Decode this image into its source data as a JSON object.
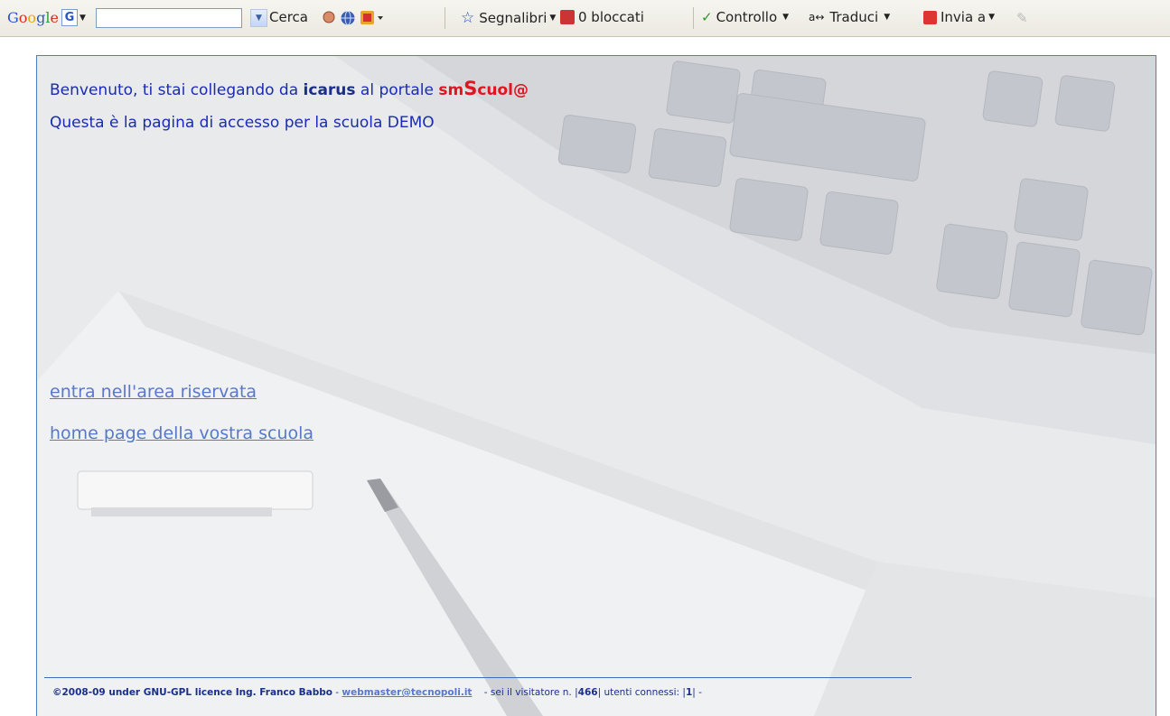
{
  "toolbar": {
    "logo_text": "Google",
    "g_button": "G",
    "search_placeholder": "",
    "search_button": "Cerca",
    "bookmarks": "Segnalibri",
    "blocked": "0 bloccati",
    "check": "Controllo",
    "translate": "Traduci",
    "send": "Invia a"
  },
  "page": {
    "welcome_prefix": "Benvenuto, ti stai collegando da ",
    "host": "icarus",
    "welcome_mid": " al portale ",
    "brand_a": "sm",
    "brand_b": "S",
    "brand_c": "cuol@",
    "access_text": "Questa è la pagina di accesso per la scuola DEMO",
    "link_reserved": "entra nell'area riservata",
    "link_home": "home page della vostra scuola"
  },
  "footer": {
    "copyright": "©2008-09 under GNU-GPL licence Ing. Franco Babbo",
    "dash": " - ",
    "email": "webmaster@tecnopoli.it",
    "visitor_prefix": "    - sei il visitatore n. |",
    "visitor_count": "466",
    "users_prefix": "| utenti connessi: |",
    "users_count": "1",
    "suffix": "| -"
  },
  "colors": {
    "text_blue": "#1a2bb5",
    "link_blue": "#5a78c9",
    "brand_red": "#e0151f",
    "frame_border": "#4d7fc4"
  }
}
